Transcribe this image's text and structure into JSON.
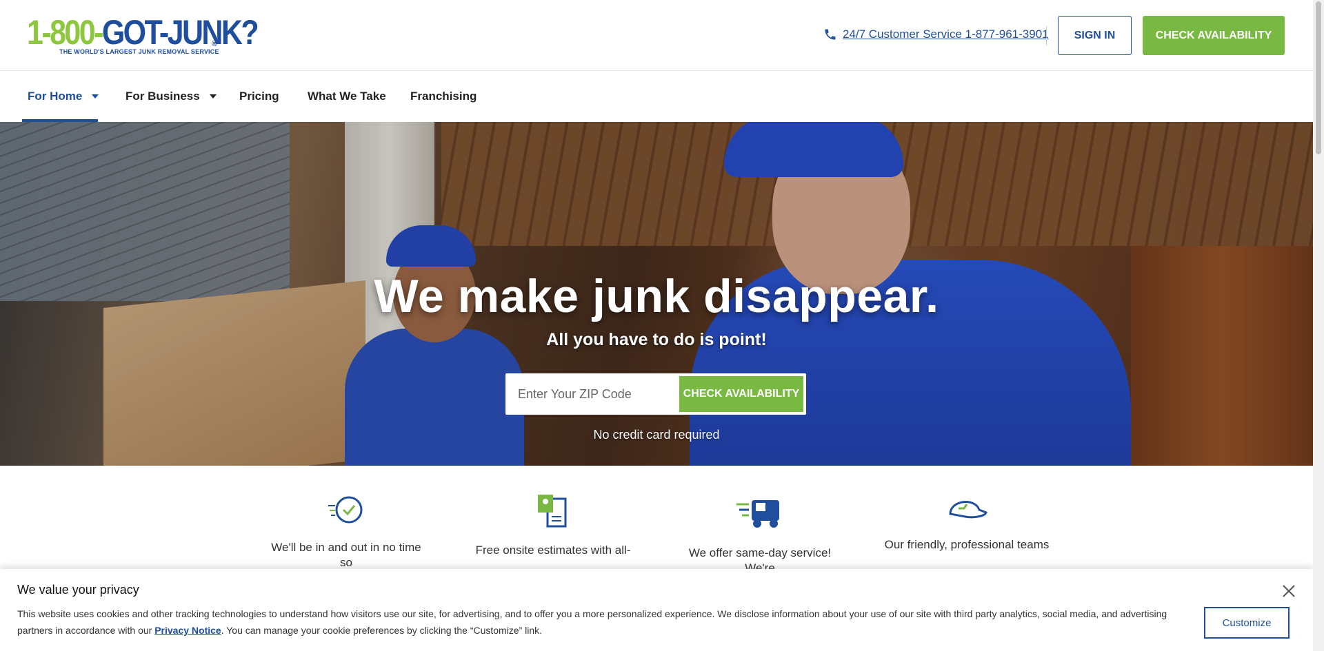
{
  "logo": {
    "part1": "1-800-",
    "part2": "GOT-JUNK?",
    "reg": "®",
    "tagline": "THE WORLD'S LARGEST JUNK REMOVAL SERVICE"
  },
  "header": {
    "phone_text": "24/7 Customer Service 1-877-961-3901",
    "signin_label": "SIGN IN",
    "check_label": "CHECK AVAILABILITY"
  },
  "nav": {
    "items": [
      {
        "label": "For Home",
        "has_caret": true,
        "active": true
      },
      {
        "label": "For Business",
        "has_caret": true,
        "active": false
      },
      {
        "label": "Pricing",
        "has_caret": false,
        "active": false
      },
      {
        "label": "What We Take",
        "has_caret": false,
        "active": false
      },
      {
        "label": "Franchising",
        "has_caret": false,
        "active": false
      }
    ]
  },
  "hero": {
    "title": "We make junk disappear.",
    "subtitle": "All you have to do is point!",
    "zip_placeholder": "Enter Your ZIP Code",
    "zip_value": "",
    "button_label": "CHECK AVAILABILITY",
    "note": "No credit card required"
  },
  "features": [
    {
      "icon": "clock-check-icon",
      "text": "We'll be in and out in no time so"
    },
    {
      "icon": "estimate-document-icon",
      "text": "Free onsite estimates with all-"
    },
    {
      "icon": "fast-truck-icon",
      "text": "We offer same-day service! We're"
    },
    {
      "icon": "cap-icon",
      "text": "Our friendly, professional teams"
    }
  ],
  "cookie": {
    "title": "We value your privacy",
    "text_before": "This website uses cookies and other tracking technologies to understand how visitors use our site, for advertising, and to offer you a more personalized experience. We disclose information about your use of our site with third party analytics, social media, and advertising partners in accordance with our ",
    "link_label": "Privacy Notice",
    "text_after": ". You can manage your cookie preferences by clicking the “Customize” link.",
    "customize_label": "Customize"
  },
  "colors": {
    "brand_blue": "#1f4e9c",
    "brand_green": "#78b843",
    "logo_green": "#8dc63f"
  }
}
